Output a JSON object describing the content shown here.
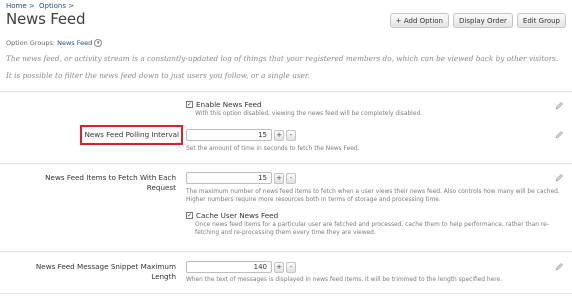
{
  "breadcrumb": [
    "Home >",
    "Options >"
  ],
  "page_title": "News Feed",
  "actions": {
    "add_option": "+ Add Option",
    "display_order": "Display Order",
    "edit_group": "Edit Group"
  },
  "option_groups": {
    "label": "Option Groups:",
    "value": "News Feed"
  },
  "description": [
    "The news feed, or activity stream is a constantly-updated log of things that your registered members do, which can be viewed back by other visitors.",
    "It is possible to filter the news feed down to just users you follow, or a single user."
  ],
  "options": {
    "enable": {
      "label": "Enable News Feed",
      "checked": true,
      "hint": "With this option disabled, viewing the news feed will be completely disabled."
    },
    "polling": {
      "label": "News Feed Polling Interval",
      "value": "15",
      "hint": "Set the amount of time in seconds to fetch the News Feed."
    },
    "items_fetch": {
      "label_line1": "News Feed Items to Fetch With Each",
      "label_line2": "Request",
      "value": "15",
      "hint_line1": "The maximum number of news feed items to fetch when a user views their news feed. Also controls how many will be cached.",
      "hint_line2": "Higher numbers require more resources both in terms of storage and processing time."
    },
    "cache": {
      "label": "Cache User News Feed",
      "checked": true,
      "hint_line1": "Once news feed items for a particular user are fetched and processed, cache them to help performance, rather than re-",
      "hint_line2": "fetching and re-processing them every time they are viewed."
    },
    "snippet": {
      "label_line1": "News Feed Message Snippet Maximum",
      "label_line2": "Length",
      "value": "140",
      "hint": "When the text of messages is displayed in news feed items, it will be trimmed to the length specified here."
    }
  },
  "stepper": {
    "plus": "+",
    "minus": "-"
  },
  "icons": {
    "edit": "pencil-icon",
    "checkbox": "check-icon",
    "dropdown": "chevron-down-icon"
  },
  "colors": {
    "highlight": "#d9222a",
    "link": "#2b4e7a"
  }
}
